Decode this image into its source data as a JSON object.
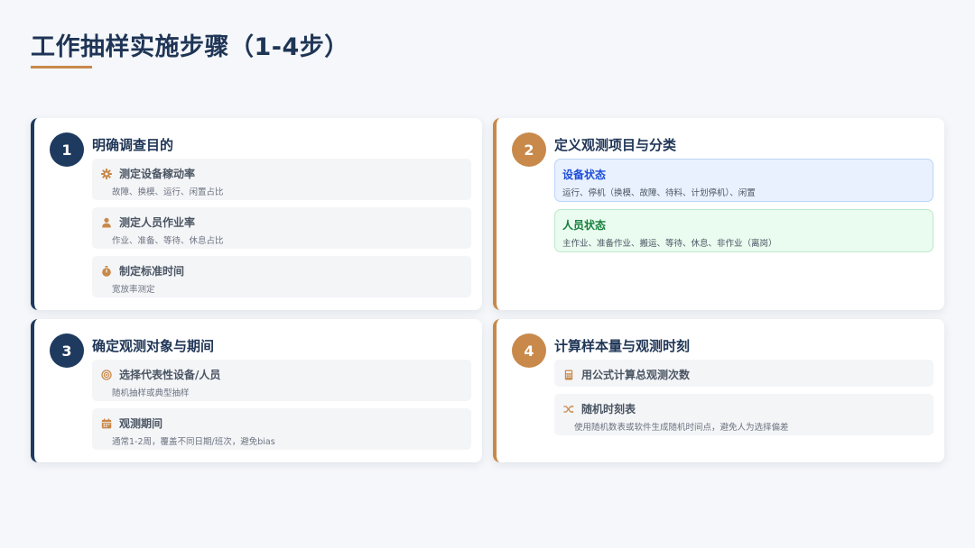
{
  "page": {
    "title": "工作抽样实施步骤（1-4步）"
  },
  "colors": {
    "navy": "#1f3a5f",
    "gold": "#c8894a",
    "blue_label": "#1d4ed8",
    "green_label": "#15803d"
  },
  "steps": [
    {
      "number": "1",
      "title": "明确调查目的",
      "items": [
        {
          "icon": "gear-icon",
          "label": "测定设备稼动率",
          "desc": "故障、换模、运行、闲置占比"
        },
        {
          "icon": "person-icon",
          "label": "测定人员作业率",
          "desc": "作业、准备、等待、休息占比"
        },
        {
          "icon": "stopwatch-icon",
          "label": "制定标准时间",
          "desc": "宽放率测定"
        }
      ]
    },
    {
      "number": "2",
      "title": "定义观测项目与分类",
      "statuses": [
        {
          "label": "设备状态",
          "desc": "运行、停机（换模、故障、待料、计划停机）、闲置"
        },
        {
          "label": "人员状态",
          "desc": "主作业、准备作业、搬运、等待、休息、非作业（离岗）"
        }
      ]
    },
    {
      "number": "3",
      "title": "确定观测对象与期间",
      "items": [
        {
          "icon": "target-icon",
          "label": "选择代表性设备/人员",
          "desc": "随机抽样或典型抽样"
        },
        {
          "icon": "calendar-icon",
          "label": "观测期间",
          "desc": "通常1-2周，覆盖不同日期/班次，避免bias"
        }
      ]
    },
    {
      "number": "4",
      "title": "计算样本量与观测时刻",
      "items": [
        {
          "icon": "calculator-icon",
          "label": "用公式计算总观测次数",
          "desc": ""
        },
        {
          "icon": "shuffle-icon",
          "label": "随机时刻表",
          "desc": "使用随机数表或软件生成随机时间点，避免人为选择偏差"
        }
      ]
    }
  ]
}
